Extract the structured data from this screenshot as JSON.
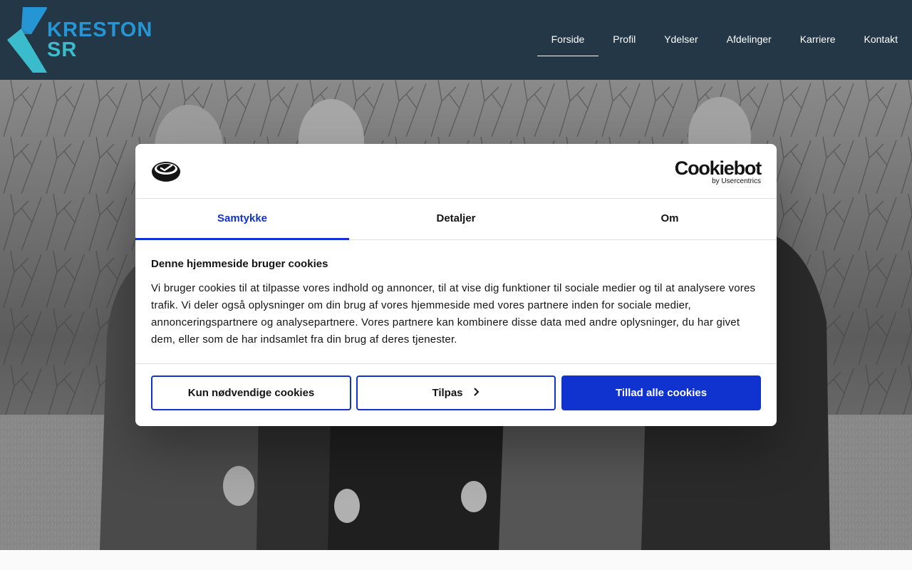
{
  "header": {
    "logo": {
      "line1": "KRESTON",
      "line2": "SR"
    },
    "nav": [
      {
        "label": "Forside",
        "active": true
      },
      {
        "label": "Profil",
        "active": false
      },
      {
        "label": "Ydelser",
        "active": false
      },
      {
        "label": "Afdelinger",
        "active": false
      },
      {
        "label": "Karriere",
        "active": false
      },
      {
        "label": "Kontakt",
        "active": false
      }
    ]
  },
  "cookie_dialog": {
    "brand": {
      "name": "Cookiebot",
      "sub": "by Usercentrics"
    },
    "tabs": [
      {
        "label": "Samtykke",
        "active": true
      },
      {
        "label": "Detaljer",
        "active": false
      },
      {
        "label": "Om",
        "active": false
      }
    ],
    "title": "Denne hjemmeside bruger cookies",
    "body": "Vi bruger cookies til at tilpasse vores indhold og annoncer, til at vise dig funktioner til sociale medier og til at analysere vores trafik. Vi deler også oplysninger om din brug af vores hjemmeside med vores partnere inden for sociale medier, annonceringspartnere og analysepartnere. Vores partnere kan kombinere disse data med andre oplysninger, du har givet dem, eller som de har indsamlet fra din brug af deres tjenester.",
    "buttons": {
      "necessary": "Kun nødvendige cookies",
      "customize": "Tilpas",
      "allow_all": "Tillad alle cookies"
    }
  },
  "colors": {
    "header_bg": "#233746",
    "logo_blue": "#2596d3",
    "logo_teal": "#3bbccc",
    "accent": "#1032cf",
    "text": "#141414"
  },
  "icons": {
    "cookiebot_logo": "cookiebot-logo-icon",
    "tilpas_chevron": "chevron-right-icon"
  },
  "hero": {
    "description_image": "black-and-white team photo of five men outdoors"
  }
}
